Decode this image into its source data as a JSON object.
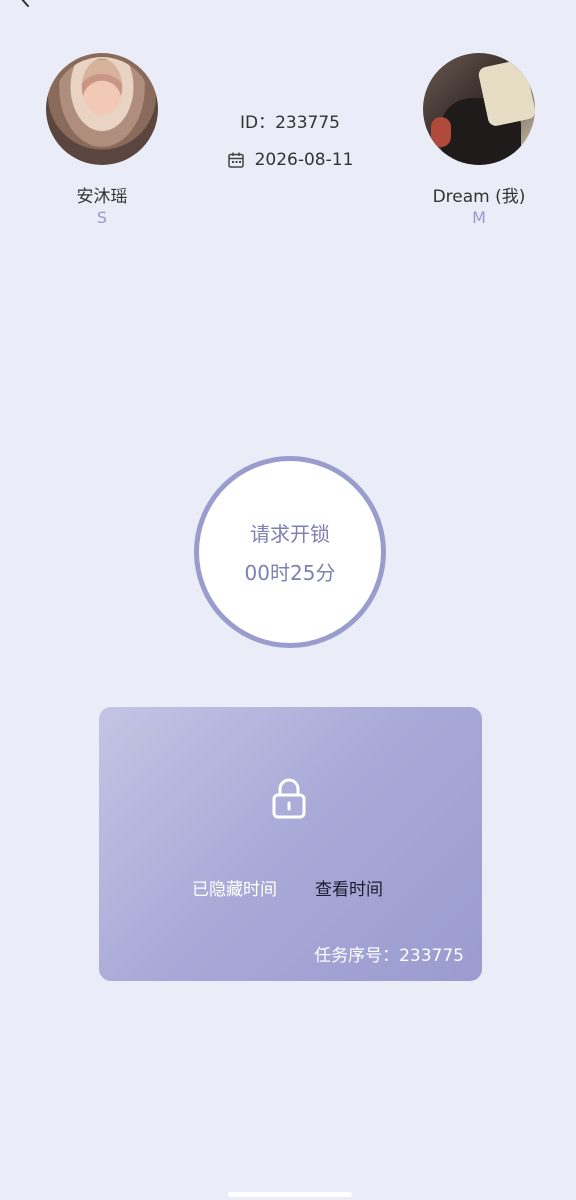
{
  "header": {
    "back_icon": "chevron-left-icon"
  },
  "users": {
    "left": {
      "name": "安沐瑶",
      "role": "S"
    },
    "right": {
      "name": "Dream (我)",
      "role": "M"
    }
  },
  "info": {
    "id": "ID：233775",
    "date": "2026-08-11",
    "date_icon": "calendar-icon"
  },
  "unlock": {
    "label": "请求开锁",
    "time": "00时25分"
  },
  "card": {
    "lock_icon": "lock-icon",
    "hidden_label": "已隐藏时间",
    "view_label": "查看时间",
    "task_no": "任务序号：233775"
  },
  "colors": {
    "background": "#eaedf7",
    "accent": "#9a9ccd",
    "role_text": "#9a9ac8",
    "card_gradient_start": "#c4c4e4",
    "card_gradient_end": "#9a9bcf"
  }
}
